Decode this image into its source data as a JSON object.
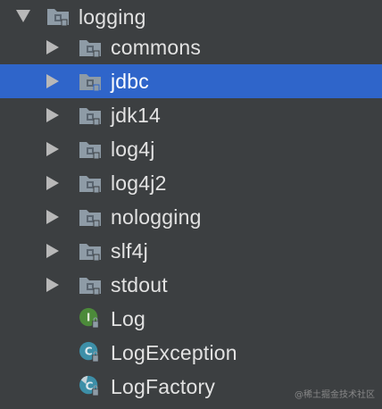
{
  "project_tree": {
    "root": {
      "label": "logging",
      "icon": "package-folder-icon",
      "expanded": true
    },
    "packages": [
      {
        "label": "commons",
        "icon": "package-folder-icon",
        "expanded": false,
        "selected": false
      },
      {
        "label": "jdbc",
        "icon": "package-folder-icon",
        "expanded": false,
        "selected": true
      },
      {
        "label": "jdk14",
        "icon": "package-folder-icon",
        "expanded": false,
        "selected": false
      },
      {
        "label": "log4j",
        "icon": "package-folder-icon",
        "expanded": false,
        "selected": false
      },
      {
        "label": "log4j2",
        "icon": "package-folder-icon",
        "expanded": false,
        "selected": false
      },
      {
        "label": "nologging",
        "icon": "package-folder-icon",
        "expanded": false,
        "selected": false
      },
      {
        "label": "slf4j",
        "icon": "package-folder-icon",
        "expanded": false,
        "selected": false
      },
      {
        "label": "stdout",
        "icon": "package-folder-icon",
        "expanded": false,
        "selected": false
      }
    ],
    "classes": [
      {
        "label": "Log",
        "icon": "interface-icon",
        "letter": "I",
        "color": "#4c8a3a"
      },
      {
        "label": "LogException",
        "icon": "class-icon",
        "letter": "C",
        "color": "#3d8fa8"
      },
      {
        "label": "LogFactory",
        "icon": "abstract-class-icon",
        "letter": "C",
        "color": "#3d8fa8"
      }
    ]
  },
  "colors": {
    "background": "#3c3f41",
    "selection": "#2f65ca",
    "folder": "#8e9ba6",
    "package_dot": "#5a6570"
  },
  "watermark": "@稀土掘金技术社区"
}
